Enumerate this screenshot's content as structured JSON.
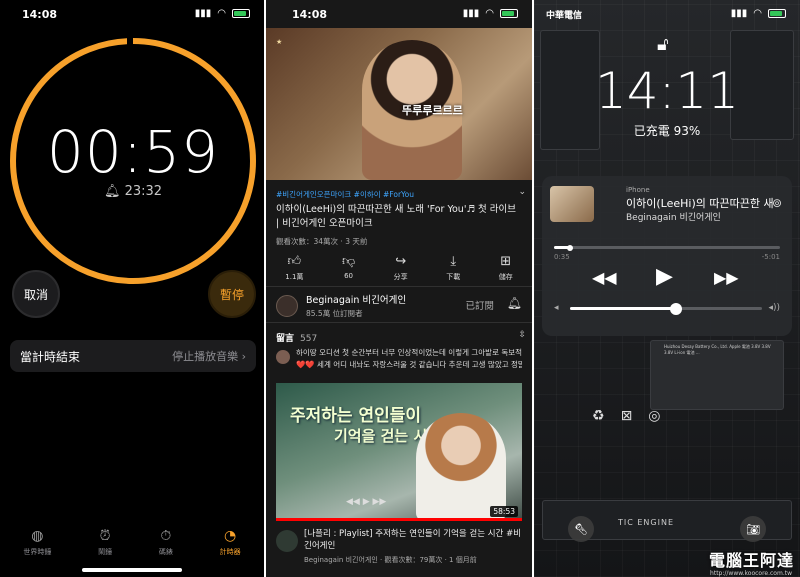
{
  "timer": {
    "status_time": "14:08",
    "countdown": "00:59",
    "alarm_icon": "bell-icon",
    "end_time": "23:32",
    "cancel_label": "取消",
    "pause_label": "暫停",
    "end_row_label": "當計時結束",
    "end_row_value": "停止播放音樂",
    "accent": "#f7a12b",
    "tabs": [
      {
        "label": "世界時鐘",
        "icon": "globe-icon"
      },
      {
        "label": "鬧鐘",
        "icon": "alarm-clock-icon"
      },
      {
        "label": "碼錶",
        "icon": "stopwatch-icon"
      },
      {
        "label": "計時器",
        "icon": "timer-icon"
      }
    ]
  },
  "youtube": {
    "status_time": "14:08",
    "video_caption": "뚜루루르르르",
    "tags": "#비긴어게인오픈마이크 #이하이 #ForYou",
    "title": "이하이(LeeHi)의 따끈따끈한 새 노래 'For You'♬ 첫 라이브 | 비긴어게인 오픈마이크",
    "meta": "觀看次數：34萬次 · 3 天前",
    "actions": [
      {
        "label": "1.1萬",
        "icon": "thumbs-up-icon"
      },
      {
        "label": "60",
        "icon": "thumbs-down-icon"
      },
      {
        "label": "分享",
        "icon": "share-icon"
      },
      {
        "label": "下載",
        "icon": "download-icon"
      },
      {
        "label": "儲存",
        "icon": "save-icon"
      }
    ],
    "channel_name": "Beginagain 비긴어게인",
    "channel_subs": "85.5萬 位訂閱者",
    "subscribed_label": "已訂閱",
    "comments_label": "留言",
    "comments_count": "557",
    "comment_line1": "하이땅 오디션 첫 순간부터 너무 인상적이었는데 이렇게 그아밭로 독보적이네요",
    "comment_line2": "❤️❤️ 세계 어디 내놔도 자랑스러울 것 같습니다 추운데 고생 많았고 정말···",
    "next_thumb_line1": "주저하는 연인들이",
    "next_thumb_line2": "기억을 걷는 시간",
    "next_duration": "58:53",
    "next_title": "[나플리 : Playlist] 주저하는 연인들이 기억을 걷는 시간 #비긴어게인",
    "next_meta": "Beginagain 비긴어게인 · 觀看次數：79萬次 · 1 個月前",
    "link_color": "#3ea6ff"
  },
  "lockscreen": {
    "carrier": "中華電信",
    "time": "14:11",
    "charged": "已充電 93%",
    "source": "iPhone",
    "track_title": "이하이(LeeHi)의 따끈따끈한 새 노래",
    "track_artist": "Beginagain 비긴어게인",
    "elapsed": "0:35",
    "remaining": "-5:01",
    "progress": 0.07,
    "volume": 0.55,
    "board_marking": "TIC ENGINE",
    "watermark": "電腦王阿達",
    "watermark_sub": "http://www.koocore.com.tw",
    "battery_text": "Huizhou Desay Battery Co., Ltd. Apple 電池 3.8V 3.8V 3.8V Li-ion 電池 ...",
    "glyphs": [
      "recycle-icon",
      "no-bin-icon",
      "ce-icon"
    ]
  }
}
